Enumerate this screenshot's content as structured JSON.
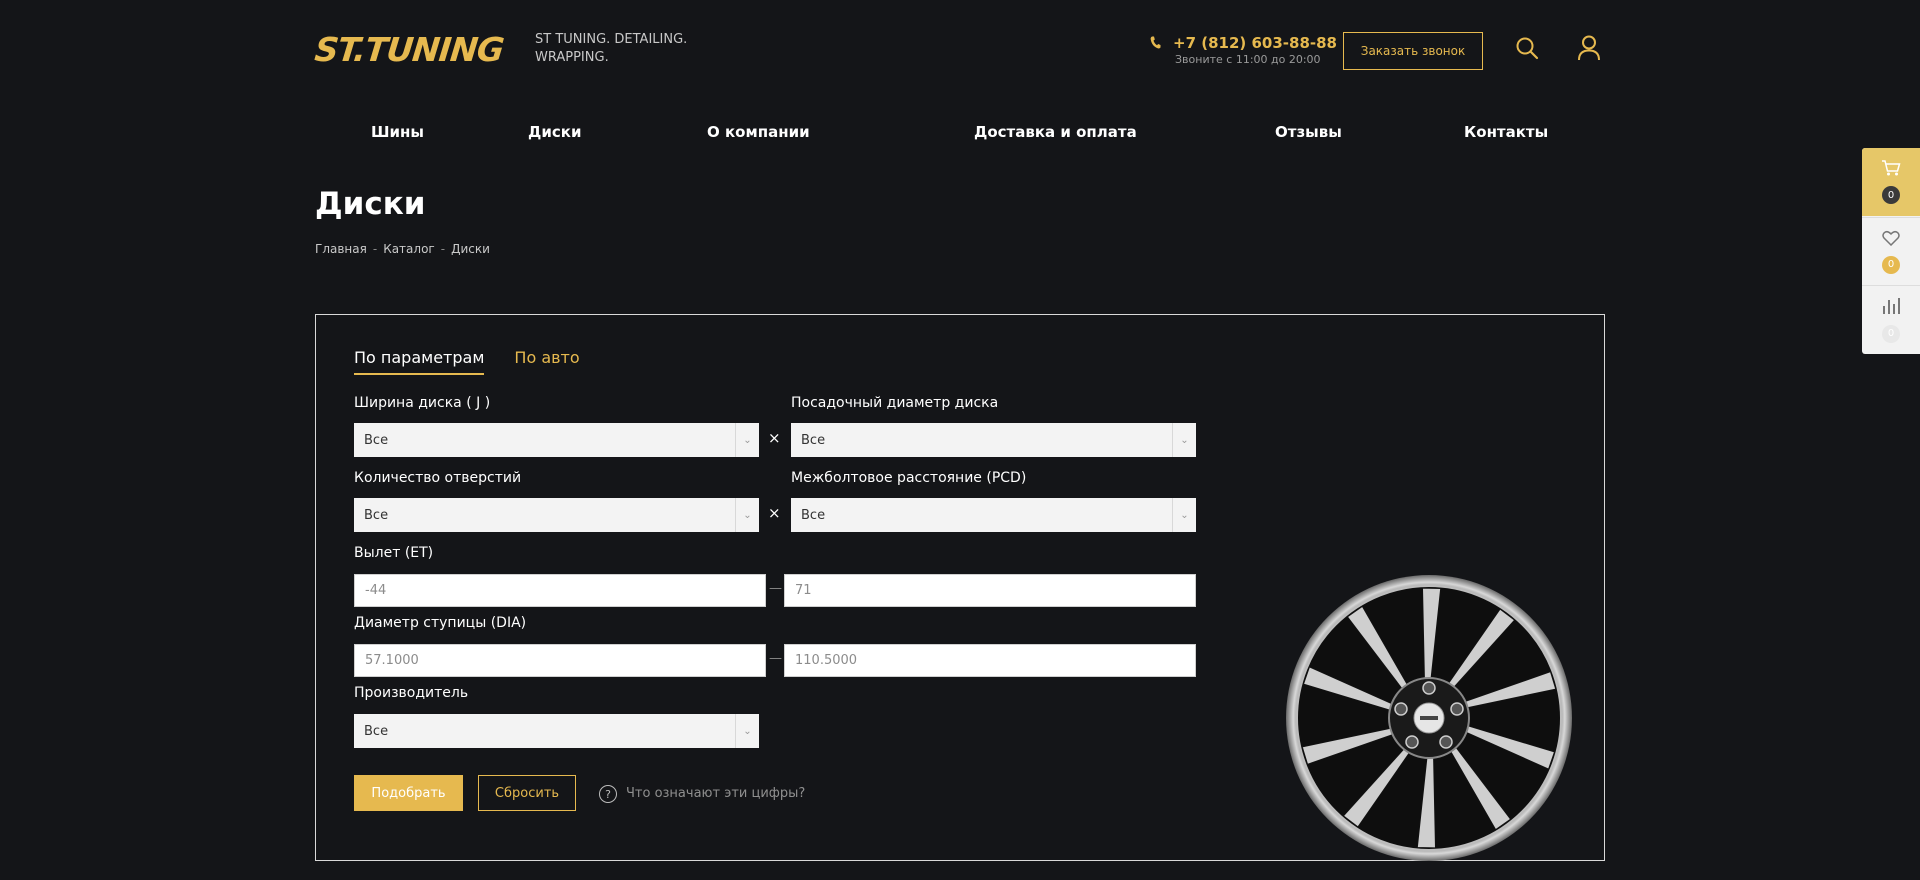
{
  "header": {
    "logo": "ST.TUNING",
    "tagline": "ST TUNING. DETAILING. WRAPPING.",
    "phone": "+7 (812) 603-88-88",
    "hours": "Звоните с 11:00 до 20:00",
    "callback_label": "Заказать звонок",
    "accent_color": "#e6b94f"
  },
  "nav": {
    "items": [
      "Шины",
      "Диски",
      "О компании",
      "Доставка и оплата",
      "Отзывы",
      "Контакты"
    ]
  },
  "page": {
    "title": "Диски",
    "breadcrumb": [
      "Главная",
      "Каталог",
      "Диски"
    ],
    "breadcrumb_separator": "-"
  },
  "filter": {
    "tabs": [
      {
        "label": "По параметрам",
        "active": true
      },
      {
        "label": "По авто",
        "active": false
      }
    ],
    "width": {
      "label": "Ширина диска ( J )",
      "value": "Все"
    },
    "diameter": {
      "label": "Посадочный диаметр диска",
      "value": "Все"
    },
    "holes": {
      "label": "Количество отверстий",
      "value": "Все"
    },
    "pcd": {
      "label": "Межболтовое расстояние (PCD)",
      "value": "Все"
    },
    "et": {
      "label": "Вылет (ET)",
      "from_placeholder": "-44",
      "to_placeholder": "71"
    },
    "dia": {
      "label": "Диаметр ступицы (DIA)",
      "from_placeholder": "57.1000",
      "to_placeholder": "110.5000"
    },
    "maker": {
      "label": "Производитель",
      "value": "Все"
    },
    "clear_symbol": "×",
    "range_dash": "—",
    "submit_label": "Подобрать",
    "reset_label": "Сбросить",
    "help_symbol": "?",
    "help_label": "Что означают эти цифры?"
  },
  "side_widget": {
    "cart_count": "0",
    "favorites_count": "0",
    "compare_count": "0"
  }
}
